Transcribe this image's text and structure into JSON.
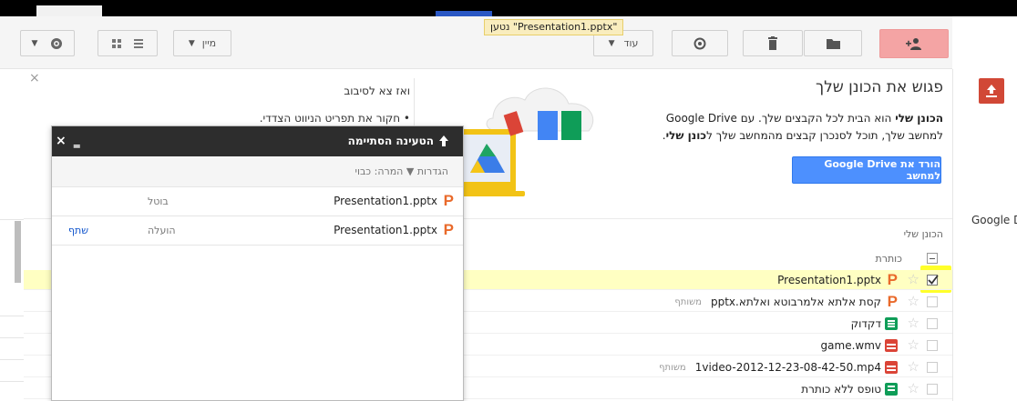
{
  "notice": {
    "text": "נטען \"Presentation1.pptx\""
  },
  "toolbar": {
    "more_label": "עוד",
    "sort_label": "מיין",
    "colors": {
      "primary_red": "#f4a4a4"
    },
    "icons": [
      "add-person-icon",
      "folder-icon",
      "trash-icon",
      "preview-icon",
      "grid-icon",
      "list-icon",
      "gear-icon",
      "chevron-down-icon"
    ]
  },
  "promo": {
    "title": "פגוש את הכונן שלך",
    "body_bold": "הכונן שלי",
    "body_rest": " הוא הבית לכל הקבצים שלך. עם Google Drive למחשב שלך, תוכל לסנכרן קבצים מהמחשב שלך ל",
    "body_bold2": "כונן שלי",
    "body_end": ".",
    "download_button": "הורד את Google Drive למחשב",
    "mid_title": "ואז צא לסיבוב",
    "mid_bullet": "חקור את תפריט הניווט הצדדי."
  },
  "side": {
    "label": "Google D"
  },
  "list": {
    "header": "הכונן שלי",
    "column_title": "כותרת",
    "rows": [
      {
        "name": "Presentation1.pptx",
        "icon": "p",
        "selected": true,
        "shared": ""
      },
      {
        "name": "קסת אלתא אלמרבוטא ואלתא.pptx",
        "icon": "p",
        "selected": false,
        "shared": "משותף"
      },
      {
        "name": "דקדוק",
        "icon": "sheet",
        "selected": false,
        "shared": ""
      },
      {
        "name": "game.wmv",
        "icon": "video",
        "selected": false,
        "shared": ""
      },
      {
        "name": "1video-2012-12-23-08-42-50.mp4",
        "icon": "video",
        "selected": false,
        "shared": "משותף"
      },
      {
        "name": "טופס ללא כותרת",
        "icon": "form",
        "selected": false,
        "shared": ""
      }
    ]
  },
  "upload": {
    "title": "הטעינה הסתיימה",
    "settings": "הגדרות ▼  המרה: כבוי",
    "items": [
      {
        "name": "Presentation1.pptx",
        "status": "בוטל",
        "action": ""
      },
      {
        "name": "Presentation1.pptx",
        "status": "הועלה",
        "action": "שתף"
      }
    ]
  }
}
